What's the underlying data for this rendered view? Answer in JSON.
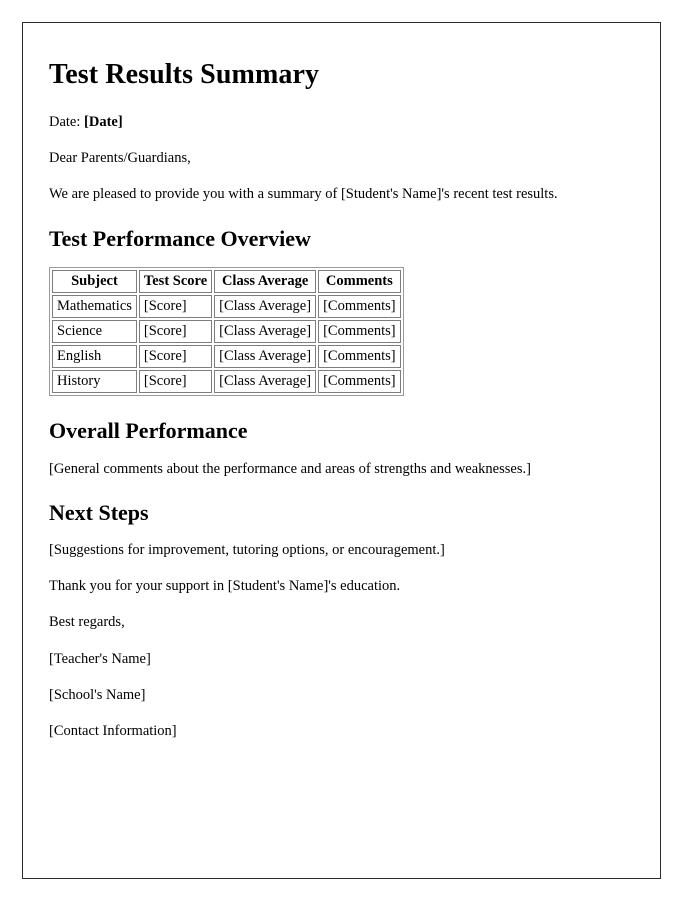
{
  "document": {
    "title": "Test Results Summary",
    "date_label": "Date:",
    "date_value": "[Date]",
    "salutation": "Dear Parents/Guardians,",
    "intro": "We are pleased to provide you with a summary of [Student's Name]'s recent test results.",
    "sections": {
      "performance_overview": {
        "heading": "Test Performance Overview",
        "table": {
          "headers": [
            "Subject",
            "Test Score",
            "Class Average",
            "Comments"
          ],
          "rows": [
            [
              "Mathematics",
              "[Score]",
              "[Class Average]",
              "[Comments]"
            ],
            [
              "Science",
              "[Score]",
              "[Class Average]",
              "[Comments]"
            ],
            [
              "English",
              "[Score]",
              "[Class Average]",
              "[Comments]"
            ],
            [
              "History",
              "[Score]",
              "[Class Average]",
              "[Comments]"
            ]
          ]
        }
      },
      "overall_performance": {
        "heading": "Overall Performance",
        "body": "[General comments about the performance and areas of strengths and weaknesses.]"
      },
      "next_steps": {
        "heading": "Next Steps",
        "body": "[Suggestions for improvement, tutoring options, or encouragement.]"
      }
    },
    "closing": {
      "thank_you": "Thank you for your support in [Student's Name]'s education.",
      "sign_off": "Best regards,",
      "teacher_name": "[Teacher's Name]",
      "school_name": "[School's Name]",
      "contact_information": "[Contact Information]"
    }
  },
  "colors": {
    "page_border": "#2b2b2b",
    "table_border": "#7d7d7d",
    "text": "#000000",
    "background": "#ffffff"
  }
}
